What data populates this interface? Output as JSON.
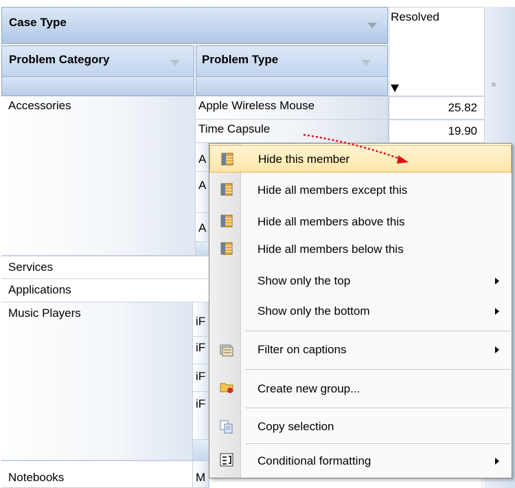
{
  "grid": {
    "case_type_header": "Case Type",
    "resolved_header": "Resolved",
    "problem_category_header": "Problem Category",
    "problem_type_header": "Problem Type",
    "rows": [
      {
        "category": "Accessories",
        "type": "Apple Wireless Mouse",
        "value": "25.82"
      },
      {
        "category": "",
        "type": "Time Capsule",
        "value": "19.90"
      }
    ],
    "partial_type_letters": [
      "A",
      "A",
      "A"
    ],
    "categories_below": [
      "Services",
      "Applications",
      "Music Players",
      "Notebooks"
    ],
    "music_type_letters": [
      "iF",
      "iF",
      "iF",
      "iF"
    ],
    "notebooks_type_letter": "M"
  },
  "context_menu": {
    "items": [
      {
        "label": "Hide this member",
        "icon": "hide-member-icon",
        "highlighted": true
      },
      {
        "label": "Hide all members except this",
        "icon": "hide-members-icon"
      },
      {
        "label": "Hide all members above this",
        "icon": "hide-members-icon"
      },
      {
        "label": "Hide all members below this",
        "icon": "hide-members-icon"
      },
      {
        "label": "Show only the top",
        "submenu": true
      },
      {
        "label": "Show only the bottom",
        "submenu": true
      },
      {
        "label": "Filter on captions",
        "icon": "filter-captions-icon",
        "submenu": true
      },
      {
        "label": "Create new group...",
        "icon": "new-group-icon"
      },
      {
        "label": "Copy selection",
        "icon": "copy-icon"
      },
      {
        "label": "Conditional formatting",
        "icon": "conditional-formatting-icon",
        "submenu": true
      }
    ]
  },
  "colors": {
    "header_blue": "#c4d6ee",
    "highlight": "#fde6a8",
    "annotation_arrow": "#e01010"
  }
}
